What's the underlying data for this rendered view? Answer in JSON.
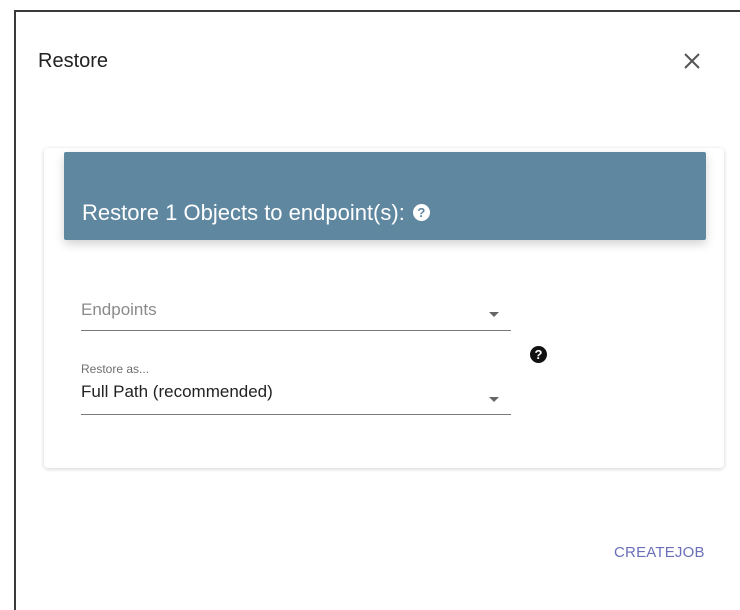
{
  "dialog": {
    "title": "Restore",
    "close_icon": "close-icon"
  },
  "card": {
    "header_text": "Restore 1 Objects to endpoint(s):",
    "header_help_icon": "question-circle-icon",
    "header_help_glyph": "?",
    "header_color": "#5f87a0"
  },
  "form": {
    "endpoints": {
      "placeholder": "Endpoints",
      "value": ""
    },
    "restore_as": {
      "label": "Restore as...",
      "value": "Full Path (recommended)"
    },
    "help_icon": "question-circle-icon",
    "help_glyph": "?"
  },
  "actions": {
    "create_job_label": "CREATEJOB",
    "create_job_color": "#6a6fb8"
  }
}
